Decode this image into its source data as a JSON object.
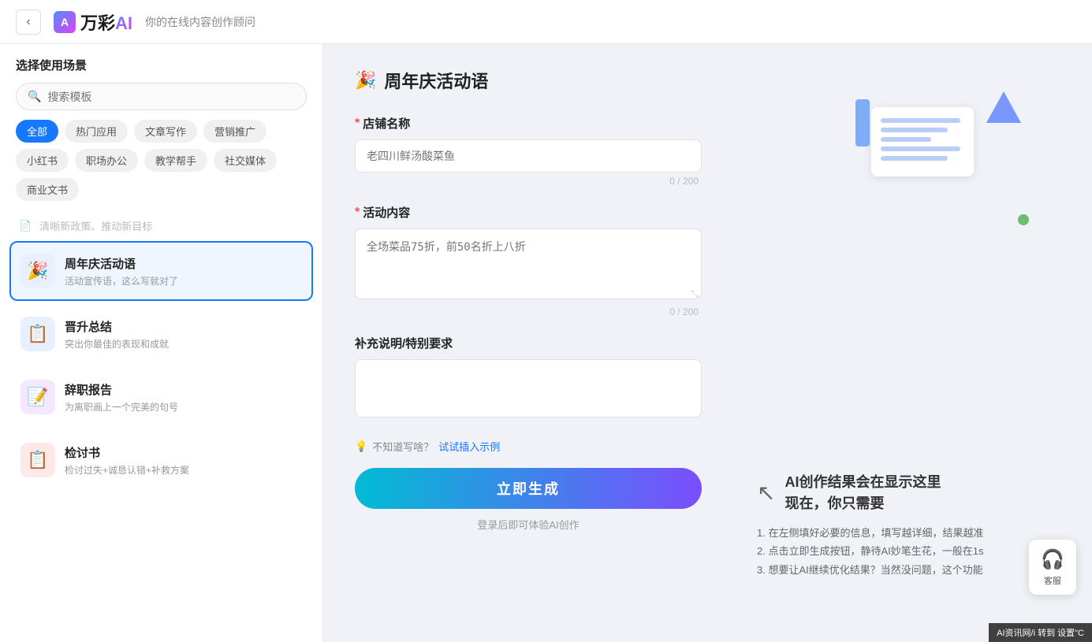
{
  "header": {
    "back_label": "‹",
    "logo_text": "万彩",
    "logo_ai": "AI",
    "subtitle": "你的在线内容创作顾问"
  },
  "sidebar": {
    "title": "选择使用场景",
    "search_placeholder": "搜索模板",
    "categories": [
      {
        "id": "all",
        "label": "全部",
        "active": true
      },
      {
        "id": "hot",
        "label": "热门应用",
        "active": false
      },
      {
        "id": "article",
        "label": "文章写作",
        "active": false
      },
      {
        "id": "marketing",
        "label": "营销推广",
        "active": false
      },
      {
        "id": "xiaohongshu",
        "label": "小红书",
        "active": false
      },
      {
        "id": "office",
        "label": "职场办公",
        "active": false
      },
      {
        "id": "education",
        "label": "教学帮手",
        "active": false
      },
      {
        "id": "social",
        "label": "社交媒体",
        "active": false
      },
      {
        "id": "business",
        "label": "商业文书",
        "active": false
      }
    ],
    "separator_text": "清晰新政策、推动新目标",
    "templates": [
      {
        "id": "anniversary",
        "name": "周年庆活动语",
        "desc": "活动宣传语，这么写就对了",
        "icon": "🎉",
        "icon_class": "blue",
        "active": true
      },
      {
        "id": "promotion",
        "name": "晋升总结",
        "desc": "突出你最佳的表现和成就",
        "icon": "📋",
        "icon_class": "blue",
        "active": false
      },
      {
        "id": "resignation",
        "name": "辞职报告",
        "desc": "为离职画上一个完美的句号",
        "icon": "📝",
        "icon_class": "purple",
        "active": false
      },
      {
        "id": "review",
        "name": "检讨书",
        "desc": "检讨过失+诚恳认错+补救方案",
        "icon": "📋",
        "icon_class": "red",
        "active": false
      }
    ]
  },
  "form": {
    "title": "周年庆活动语",
    "title_icon": "🎉",
    "fields": [
      {
        "id": "store_name",
        "label": "店铺名称",
        "required": true,
        "placeholder": "老四川鲜汤酸菜鱼",
        "type": "input",
        "counter": "0 / 200"
      },
      {
        "id": "activity_content",
        "label": "活动内容",
        "required": true,
        "placeholder": "全场菜品75折，前50名折上八折",
        "type": "textarea",
        "counter": "0 / 200"
      },
      {
        "id": "supplement",
        "label": "补充说明/特别要求",
        "required": false,
        "placeholder": "",
        "type": "textarea",
        "counter": ""
      }
    ],
    "hint_icon": "💡",
    "hint_text": "不知道写啥？试试插入示例",
    "generate_label": "立即生成",
    "login_hint": "登录后即可体验AI创作"
  },
  "preview": {
    "ai_title_line1": "AI创作结果会在显示这里",
    "ai_title_line2": "现在，你只需要",
    "steps": [
      "1. 在左侧填好必要的信息，填写越详细，结果越准",
      "2. 点击立即生成按钮，静待AI妙笔生花，一般在1s",
      "3. 想要让AI继续优化结果？当然没问题，这个功能"
    ]
  },
  "customer_service": {
    "label": "客服"
  },
  "watermark": {
    "text": "AI资讯网/i"
  }
}
